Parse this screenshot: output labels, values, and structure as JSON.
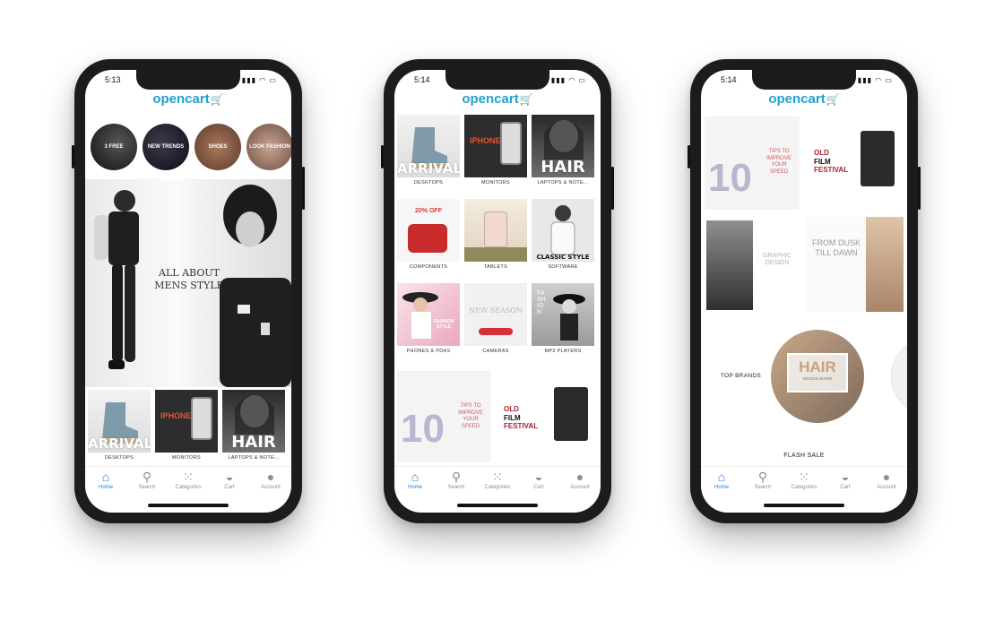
{
  "accent_color": "#2a7de1",
  "brand_color": "#23a1d1",
  "logo": {
    "text": "opencart",
    "cart_glyph": "🛒"
  },
  "tabs": [
    {
      "label": "Home",
      "icon": "home-icon"
    },
    {
      "label": "Search",
      "icon": "search-icon"
    },
    {
      "label": "Categories",
      "icon": "grid-icon"
    },
    {
      "label": "Cart",
      "icon": "basket-icon"
    },
    {
      "label": "Account",
      "icon": "user-icon"
    }
  ],
  "phone1": {
    "time": "5:13",
    "circles": [
      {
        "text": "3 FREE"
      },
      {
        "text": "NEW TRENDS"
      },
      {
        "text": "SHOES"
      },
      {
        "text": "LOOK FASHION"
      }
    ],
    "hero_text": "ALL ABOUT MENS STYLE",
    "tiles": [
      {
        "caption": "DESKTOPS",
        "big": "ARRIVAL"
      },
      {
        "caption": "MONITORS",
        "big": "IPHONE"
      },
      {
        "caption": "LAPTOPS & NOTE...",
        "big": "HAIR"
      }
    ]
  },
  "phone2": {
    "time": "5:14",
    "grid": [
      {
        "caption": "DESKTOPS",
        "big": "ARRIVAL"
      },
      {
        "caption": "MONITORS",
        "big": "IPHONE"
      },
      {
        "caption": "LAPTOPS & NOTE...",
        "big": "HAIR"
      },
      {
        "caption": "COMPONENTS",
        "big": "20% OFF"
      },
      {
        "caption": "TABLETS",
        "big": ""
      },
      {
        "caption": "SOFTWARE",
        "big": "CLASSIC STYLE"
      },
      {
        "caption": "PHONES & PDAS",
        "big": "FASHION STYLE"
      },
      {
        "caption": "CAMERAS",
        "big": "NEW SEASON"
      },
      {
        "caption": "MP3 PLAYERS",
        "big": "FASHION"
      }
    ],
    "promos": [
      {
        "number": "10",
        "text": "TIPS TO IMPROVE YOUR SPEED"
      },
      {
        "line1": "OLD",
        "line2": "FILM",
        "line3": "FESTIVAL"
      }
    ]
  },
  "phone3": {
    "time": "5:14",
    "promos": [
      {
        "number": "10",
        "text": "TIPS TO IMPROVE YOUR SPEED"
      },
      {
        "line1": "OLD",
        "line2": "FILM",
        "line3": "FESTIVAL"
      },
      {
        "text": "GRAPHIC DESIGN"
      },
      {
        "text": "FROM DUSK TILL DAWN"
      }
    ],
    "top_brands_label": "TOP BRANDS",
    "brand_title": "HAIR",
    "brand_sub": "DESIGN SHOW",
    "flash_sale_label": "FLASH SALE"
  }
}
